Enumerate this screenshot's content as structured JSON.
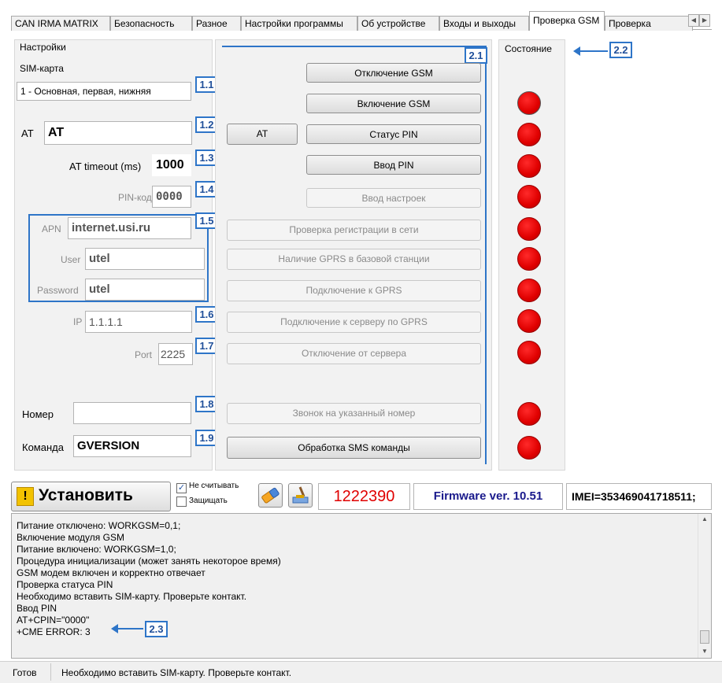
{
  "tabs": [
    "CAN IRMA MATRIX",
    "Безопасность",
    "Разное",
    "Настройки программы",
    "Об устройстве",
    "Входы и выходы",
    "Проверка GSM",
    "Проверка"
  ],
  "settings": {
    "group_title": "Настройки",
    "sim_label": "SIM-карта",
    "sim_value": "1 - Основная, первая, нижняя",
    "at_label": "AT",
    "at_value": "AT",
    "at_timeout_label": "AT timeout (ms)",
    "at_timeout_value": "1000",
    "pin_label": "PIN-код",
    "pin_value": "0000",
    "apn_label": "APN",
    "apn_value": "internet.usi.ru",
    "user_label": "User",
    "user_value": "utel",
    "password_label": "Password",
    "password_value": "utel",
    "ip_label": "IP",
    "ip_value": "1.1.1.1",
    "port_label": "Port",
    "port_value": "2225",
    "number_label": "Номер",
    "number_value": "",
    "command_label": "Команда",
    "command_value": "GVERSION"
  },
  "at_button": "AT",
  "actions": [
    {
      "label": "Отключение GSM",
      "enabled": true
    },
    {
      "label": "Включение GSM",
      "enabled": true
    },
    {
      "label": "Статус PIN",
      "enabled": true
    },
    {
      "label": "Ввод PIN",
      "enabled": true
    },
    {
      "label": "Ввод настроек",
      "enabled": false
    },
    {
      "label": "Проверка регистрации в сети",
      "enabled": false
    },
    {
      "label": "Наличие GPRS в базовой станции",
      "enabled": false
    },
    {
      "label": "Подключение к GPRS",
      "enabled": false
    },
    {
      "label": "Подключение к серверу по GPRS",
      "enabled": false
    },
    {
      "label": "Отключение от сервера",
      "enabled": false
    },
    {
      "label": "Звонок на указанный номер",
      "enabled": false
    },
    {
      "label": "Обработка SMS команды",
      "enabled": true
    }
  ],
  "status": {
    "title": "Состояние",
    "indicators": [
      "hatched",
      "red",
      "red",
      "red",
      "red",
      "red",
      "red",
      "red",
      "red",
      "none",
      "red",
      "red"
    ]
  },
  "markers": {
    "m11": "1.1",
    "m12": "1.2",
    "m13": "1.3",
    "m14": "1.4",
    "m15": "1.5",
    "m16": "1.6",
    "m17": "1.7",
    "m18": "1.8",
    "m19": "1.9",
    "m21": "2.1",
    "m22": "2.2",
    "m23": "2.3"
  },
  "toolbar": {
    "install_label": "Установить",
    "no_read_label": "Не считывать",
    "no_read_checked": true,
    "protect_label": "Защищать",
    "protect_checked": false,
    "serial": "1222390",
    "firmware": "Firmware ver. 10.51",
    "imei": "IMEI=353469041718511;"
  },
  "colors": {
    "accent": "#2e75c8",
    "indicator_red": "#e00000",
    "serial_red": "#e00000",
    "firmware_blue": "#1a1a8c"
  },
  "log": [
    "Питание отключено: WORKGSM=0,1;",
    "Включение модуля GSM",
    "Питание включено: WORKGSM=1,0;",
    "Процедура инициализации (может занять некоторое время)",
    "GSM модем включен и корректно отвечает",
    "Проверка статуса PIN",
    "Необходимо вставить SIM-карту. Проверьте контакт.",
    "Ввод PIN",
    "AT+CPIN=\"0000\"",
    "+CME ERROR: 3"
  ],
  "statusbar": {
    "state": "Готов",
    "message": "Необходимо вставить SIM-карту. Проверьте контакт."
  }
}
